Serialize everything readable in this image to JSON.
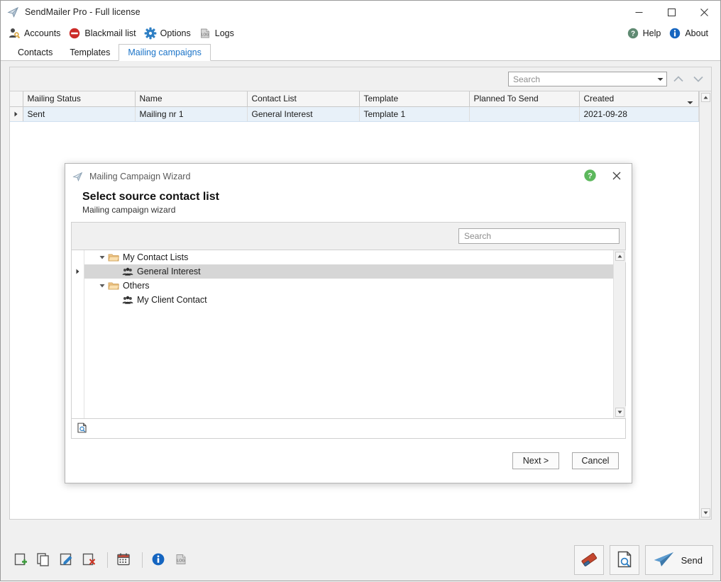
{
  "window": {
    "title": "SendMailer Pro - Full license",
    "app_icon": "paper-plane-icon",
    "minimize_label": "Minimize",
    "maximize_label": "Maximize",
    "close_label": "Close"
  },
  "menustrip": {
    "items": [
      {
        "label": "Accounts",
        "icon": "user-key-icon"
      },
      {
        "label": "Blackmail list",
        "icon": "block-icon"
      },
      {
        "label": "Options",
        "icon": "gear-icon"
      },
      {
        "label": "Logs",
        "icon": "log-file-icon"
      }
    ],
    "right_items": [
      {
        "label": "Help",
        "icon": "help-circle-icon",
        "color": "#5f8a72"
      },
      {
        "label": "About",
        "icon": "info-circle-icon",
        "color": "#1565c0"
      }
    ]
  },
  "tabs": [
    {
      "label": "Contacts",
      "active": false
    },
    {
      "label": "Templates",
      "active": false
    },
    {
      "label": "Mailing campaigns",
      "active": true
    }
  ],
  "grid_toolbar": {
    "search_placeholder": "Search",
    "search_value": "",
    "prev_icon": "chevron-up-icon",
    "next_icon": "chevron-down-icon"
  },
  "grid": {
    "columns": [
      "Mailing Status",
      "Name",
      "Contact List",
      "Template",
      "Planned To Send",
      "Created"
    ],
    "sorted_column": "Created",
    "rows": [
      {
        "Mailing Status": "Sent",
        "Name": "Mailing nr 1",
        "Contact List": "General Interest",
        "Template": "Template 1",
        "Planned To Send": "",
        "Created": "2021-09-28"
      }
    ]
  },
  "bottom_toolbar": {
    "left_icons": [
      {
        "name": "new-campaign-icon",
        "title": "New"
      },
      {
        "name": "copy-campaign-icon",
        "title": "Copy"
      },
      {
        "name": "edit-campaign-icon",
        "title": "Edit"
      },
      {
        "name": "delete-campaign-icon",
        "title": "Delete"
      },
      {
        "name": "schedule-calendar-icon",
        "title": "Schedule"
      },
      {
        "name": "info-circle-icon",
        "title": "Info"
      },
      {
        "name": "log-file-icon",
        "title": "Logs"
      }
    ],
    "right_buttons": [
      {
        "name": "clear-eraser-button",
        "label": ""
      },
      {
        "name": "preview-document-button",
        "label": ""
      },
      {
        "name": "send-button",
        "label": "Send",
        "icon": "paper-plane-icon"
      }
    ]
  },
  "dialog": {
    "title": "Mailing Campaign Wizard",
    "app_icon": "paper-plane-icon",
    "help_icon": "help-circle-icon",
    "help_color": "#5cb85c",
    "close_icon": "close-icon",
    "heading": "Select source contact list",
    "subheading": "Mailing campaign wizard",
    "search_placeholder": "Search",
    "search_value": "",
    "status_icon": "preview-document-icon",
    "tree": [
      {
        "label": "My Contact Lists",
        "icon": "folder-icon",
        "level": 0,
        "expanded": true,
        "selected": false
      },
      {
        "label": "General Interest",
        "icon": "contacts-group-icon",
        "level": 1,
        "expanded": null,
        "selected": true
      },
      {
        "label": "Others",
        "icon": "folder-icon",
        "level": 0,
        "expanded": true,
        "selected": false
      },
      {
        "label": "My Client Contact",
        "icon": "contacts-group-icon",
        "level": 1,
        "expanded": null,
        "selected": false
      }
    ],
    "buttons": [
      {
        "name": "next-button",
        "label": "Next >"
      },
      {
        "name": "cancel-button",
        "label": "Cancel"
      }
    ]
  }
}
